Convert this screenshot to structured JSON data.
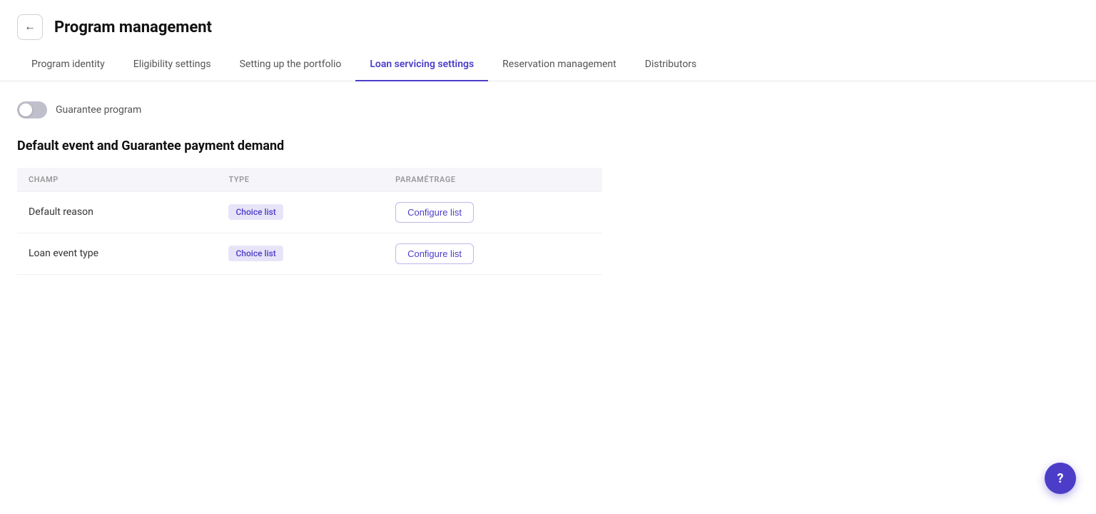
{
  "header": {
    "back_button_label": "←",
    "title": "Program management"
  },
  "nav": {
    "tabs": [
      {
        "id": "program-identity",
        "label": "Program identity",
        "active": false
      },
      {
        "id": "eligibility-settings",
        "label": "Eligibility settings",
        "active": false
      },
      {
        "id": "setting-up-the-portfolio",
        "label": "Setting up the portfolio",
        "active": false
      },
      {
        "id": "loan-servicing-settings",
        "label": "Loan servicing settings",
        "active": true
      },
      {
        "id": "reservation-management",
        "label": "Reservation management",
        "active": false
      },
      {
        "id": "distributors",
        "label": "Distributors",
        "active": false
      }
    ]
  },
  "content": {
    "toggle_label": "Guarantee program",
    "toggle_on": false,
    "section_title": "Default event and Guarantee payment demand",
    "table": {
      "columns": [
        {
          "id": "champ",
          "label": "CHAMP"
        },
        {
          "id": "type",
          "label": "TYPE"
        },
        {
          "id": "parametrage",
          "label": "PARAMÉTRAGE"
        }
      ],
      "rows": [
        {
          "champ": "Default reason",
          "type": "Choice list",
          "parametrage": "Configure list"
        },
        {
          "champ": "Loan event type",
          "type": "Choice list",
          "parametrage": "Configure list"
        }
      ]
    }
  },
  "help_button_label": "?"
}
